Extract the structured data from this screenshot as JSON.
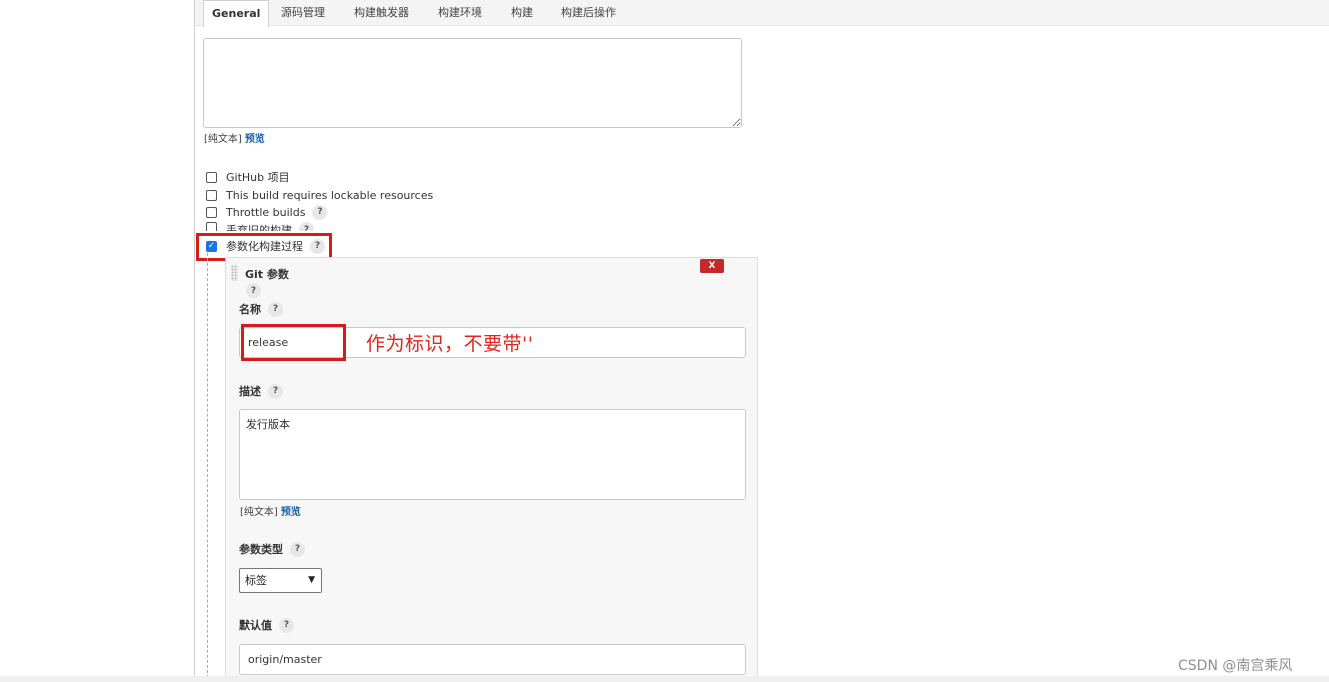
{
  "tabs": [
    "General",
    "源码管理",
    "构建触发器",
    "构建环境",
    "构建",
    "构建后操作"
  ],
  "plain_text_label": "[纯文本]",
  "preview_label": "预览",
  "options": {
    "github_project": "GitHub 项目",
    "lockable_resources": "This build requires lockable resources",
    "throttle_builds": "Throttle builds",
    "discard_old_builds": "丢弃旧的构建",
    "parameterized": "参数化构建过程"
  },
  "help_glyph": "?",
  "git_param": {
    "title": "Git 参数",
    "delete_label": "X",
    "name_label": "名称",
    "name_value": "release",
    "annotation": "作为标识，不要带''",
    "desc_label": "描述",
    "desc_value": "发行版本",
    "type_label": "参数类型",
    "type_value": "标签",
    "default_label": "默认值",
    "default_value": "origin/master"
  },
  "watermark": "CSDN @南宫乘风",
  "colors": {
    "highlight": "#d71b1b",
    "link": "#1a5fb4",
    "delete": "#c62828",
    "checkbox": "#1a73e8"
  }
}
